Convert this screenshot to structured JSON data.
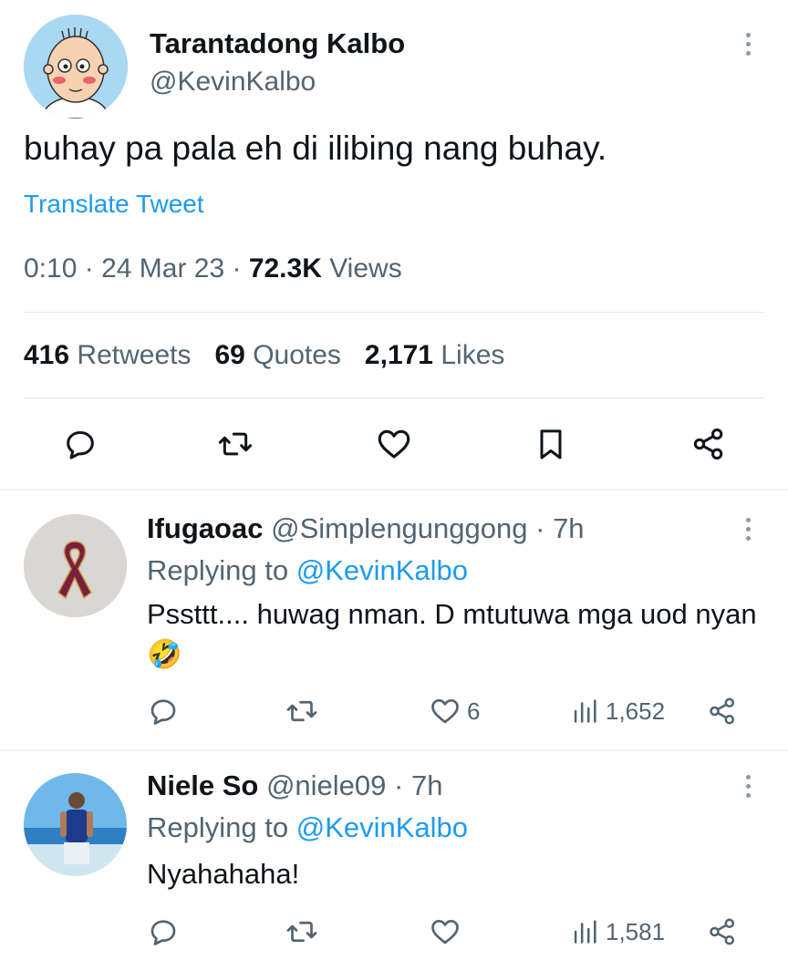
{
  "main_tweet": {
    "author_name": "Tarantadong Kalbo",
    "author_handle": "@KevinKalbo",
    "text": "buhay pa pala eh di ilibing nang buhay.",
    "translate_label": "Translate Tweet",
    "time": "0:10",
    "date": "24 Mar 23",
    "views_count": "72.3K",
    "views_label": "Views",
    "retweets_count": "416",
    "retweets_label": "Retweets",
    "quotes_count": "69",
    "quotes_label": "Quotes",
    "likes_count": "2,171",
    "likes_label": "Likes",
    "actions": [
      "reply-icon",
      "retweet-icon",
      "like-icon",
      "bookmark-icon",
      "share-icon"
    ]
  },
  "replies": [
    {
      "name": "Ifugaoac",
      "handle": "@Simplengunggong",
      "time": "7h",
      "replying_prefix": "Replying to",
      "replying_to": "@KevinKalbo",
      "text": "Pssttt.... huwag nman. D mtutuwa mga uod nyan 🤣",
      "likes": "6",
      "views": "1,652"
    },
    {
      "name": "Niele So",
      "handle": "@niele09",
      "time": "7h",
      "replying_prefix": "Replying to",
      "replying_to": "@KevinKalbo",
      "text": "Nyahahaha!",
      "likes": "",
      "views": "1,581"
    }
  ],
  "colors": {
    "text_primary": "#0f1419",
    "text_secondary": "#536471",
    "link": "#1d9bf0",
    "divider": "#eff3f4",
    "ribbon": "#7a1f3d"
  }
}
